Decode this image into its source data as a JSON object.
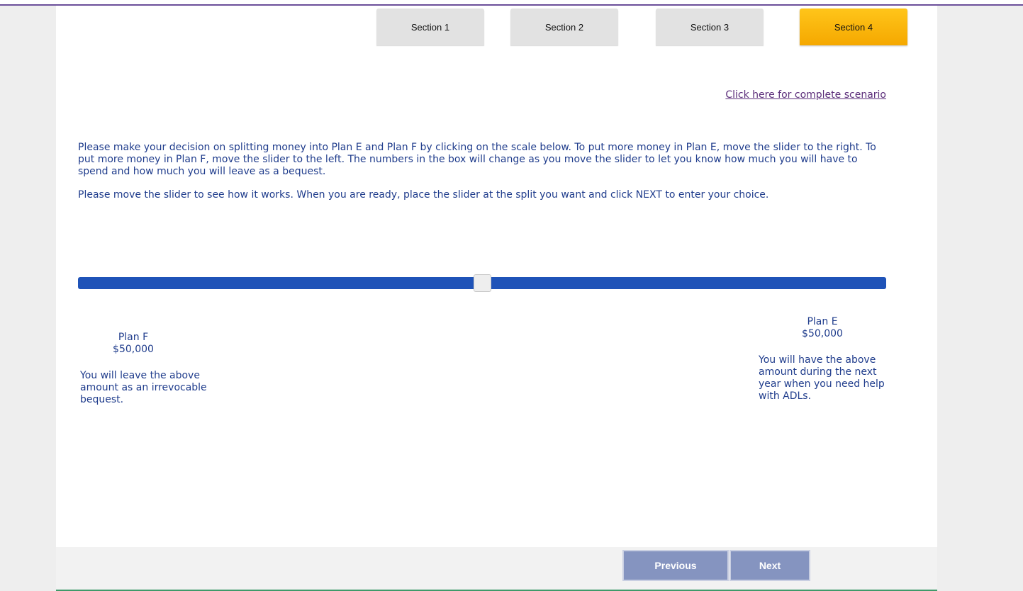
{
  "tabs": [
    "Section 1",
    "Section 2",
    "Section 3",
    "Section 4"
  ],
  "active_tab": "Section 4",
  "scenario_link": "Click here for complete scenario",
  "instructions": {
    "paragraph1": "Please make your decision on splitting money into Plan E and Plan F by clicking on the scale below. To put more money in Plan E, move the slider to the right. To put more money in Plan F, move the slider to the left. The numbers in the box will change as you move the slider to let you know how much you will have to spend and how much you will leave as a bequest.",
    "paragraph2": "Please move the slider to see how it works. When you are ready, place the slider at the split you want and click NEXT to enter your choice."
  },
  "slider": {
    "value_fraction": 0.5
  },
  "plan_f": {
    "name": "Plan F",
    "amount": "$50,000",
    "description": "You will leave the above amount as an irrevocable bequest."
  },
  "plan_e": {
    "name": "Plan E",
    "amount": "$50,000",
    "description": "You will have the above amount during the next year when you need help with ADLs."
  },
  "buttons": {
    "previous": "Previous",
    "next": "Next"
  },
  "colors": {
    "active_tab": "#f5a800",
    "slider_track": "#1f53b8",
    "text": "#1f3c8c",
    "nav_button": "#8594c0",
    "link": "#5b2d7a"
  }
}
